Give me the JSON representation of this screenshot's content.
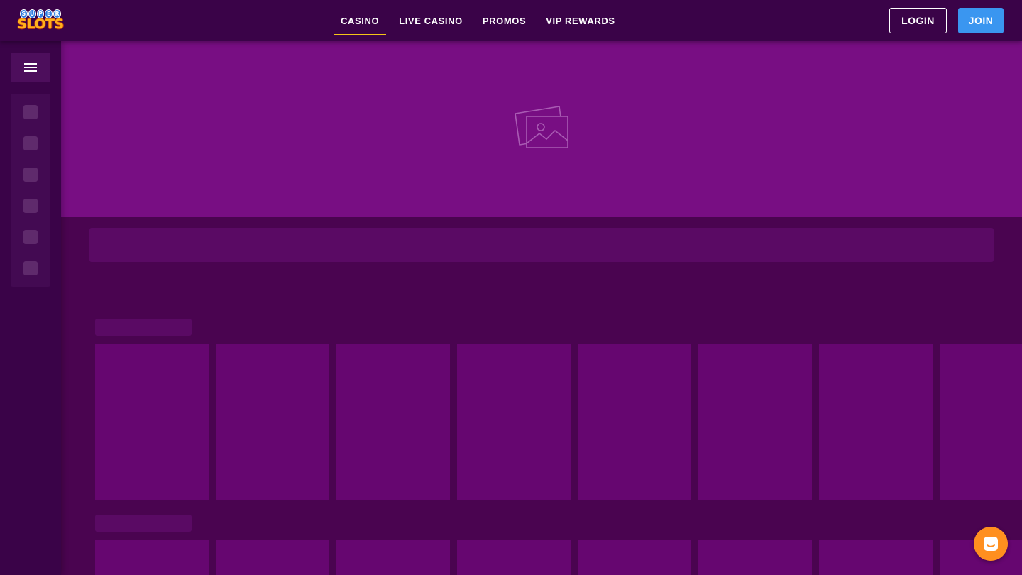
{
  "logo": {
    "super_letters": [
      "S",
      "U",
      "P",
      "E",
      "R"
    ],
    "slots_text": "SLOTS"
  },
  "nav": {
    "items": [
      {
        "label": "CASINO",
        "active": true
      },
      {
        "label": "LIVE CASINO",
        "active": false
      },
      {
        "label": "PROMOS",
        "active": false
      },
      {
        "label": "VIP REWARDS",
        "active": false
      }
    ]
  },
  "auth": {
    "login_label": "LOGIN",
    "join_label": "JOIN"
  },
  "sidebar": {
    "menu_icon": "hamburger-icon",
    "placeholder_count": 6
  },
  "banner": {
    "icon": "image-placeholder-icon"
  },
  "game_rows": [
    {
      "tiles": 8
    },
    {
      "tiles": 8
    }
  ],
  "chat": {
    "icon": "chat-icon"
  },
  "colors": {
    "page_bg": "#4a0450",
    "header_bg": "#3a0348",
    "banner_bg": "#780e83",
    "tile_bg": "#660670",
    "active_underline": "#f5c518",
    "join_button": "#3a96f0",
    "chat_button": "#ff8f1f"
  }
}
